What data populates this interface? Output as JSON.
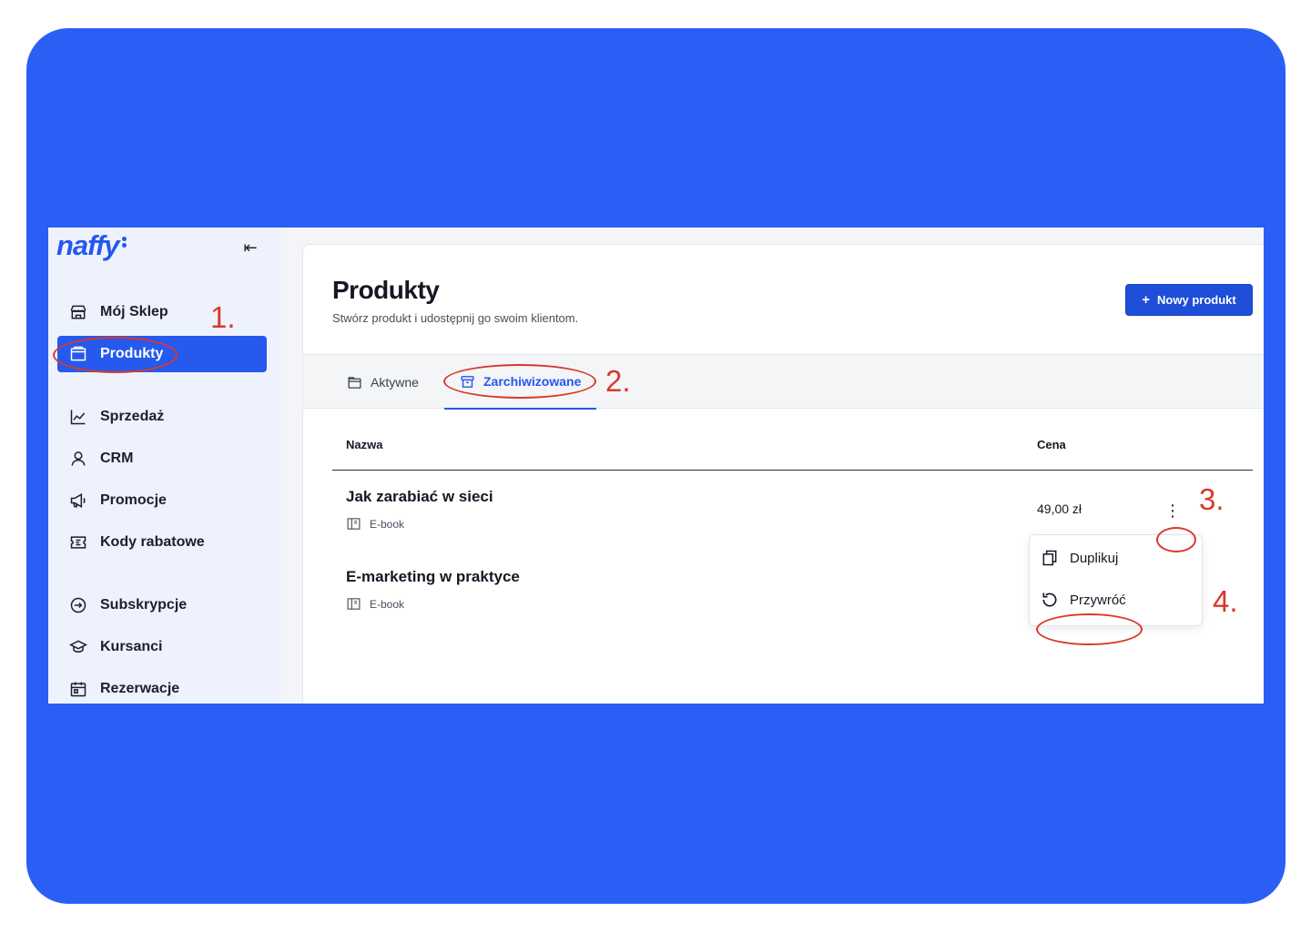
{
  "brand": {
    "logo": "naffy",
    "accent": "#2557ee",
    "background": "#2a5ff6"
  },
  "sidebar": {
    "collapse_icon": "collapse-left-icon",
    "items": [
      {
        "label": "Mój Sklep",
        "icon": "store-icon"
      },
      {
        "label": "Produkty",
        "icon": "folder-icon",
        "active": true
      },
      {
        "label": "Sprzedaż",
        "icon": "chart-line-icon"
      },
      {
        "label": "CRM",
        "icon": "user-icon"
      },
      {
        "label": "Promocje",
        "icon": "megaphone-icon"
      },
      {
        "label": "Kody rabatowe",
        "icon": "ticket-icon"
      },
      {
        "label": "Subskrypcje",
        "icon": "subscription-icon"
      },
      {
        "label": "Kursanci",
        "icon": "graduation-cap-icon"
      },
      {
        "label": "Rezerwacje",
        "icon": "calendar-icon"
      }
    ]
  },
  "header": {
    "title": "Produkty",
    "subtitle": "Stwórz produkt i udostępnij go swoim klientom.",
    "new_button": "Nowy produkt",
    "new_button_icon": "plus-icon"
  },
  "tabs": [
    {
      "label": "Aktywne",
      "icon": "folder-icon"
    },
    {
      "label": "Zarchiwizowane",
      "icon": "archive-icon",
      "active": true
    }
  ],
  "table": {
    "columns": [
      "Nazwa",
      "Cena"
    ],
    "rows": [
      {
        "name": "Jak zarabiać w sieci",
        "type": "E-book",
        "price": "49,00 zł"
      },
      {
        "name": "E-marketing w praktyce",
        "type": "E-book"
      }
    ]
  },
  "context_menu": {
    "items": [
      {
        "label": "Duplikuj",
        "icon": "duplicate-icon"
      },
      {
        "label": "Przywróć",
        "icon": "restore-icon"
      }
    ]
  },
  "annotations": {
    "steps": [
      "1.",
      "2.",
      "3.",
      "4."
    ],
    "color": "#d8392b"
  }
}
